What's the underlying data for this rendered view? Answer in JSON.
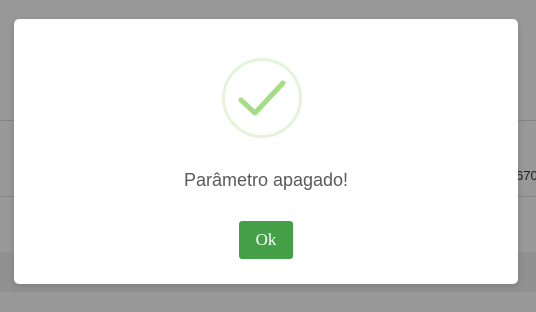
{
  "background": {
    "partial_text": "670"
  },
  "dialog": {
    "icon": "check-icon",
    "message": "Parâmetro apagado!",
    "ok_label": "Ok"
  },
  "colors": {
    "success_check": "#a5dc86",
    "ok_button": "#43a047",
    "backdrop": "rgba(0,0,0,0.4)"
  }
}
